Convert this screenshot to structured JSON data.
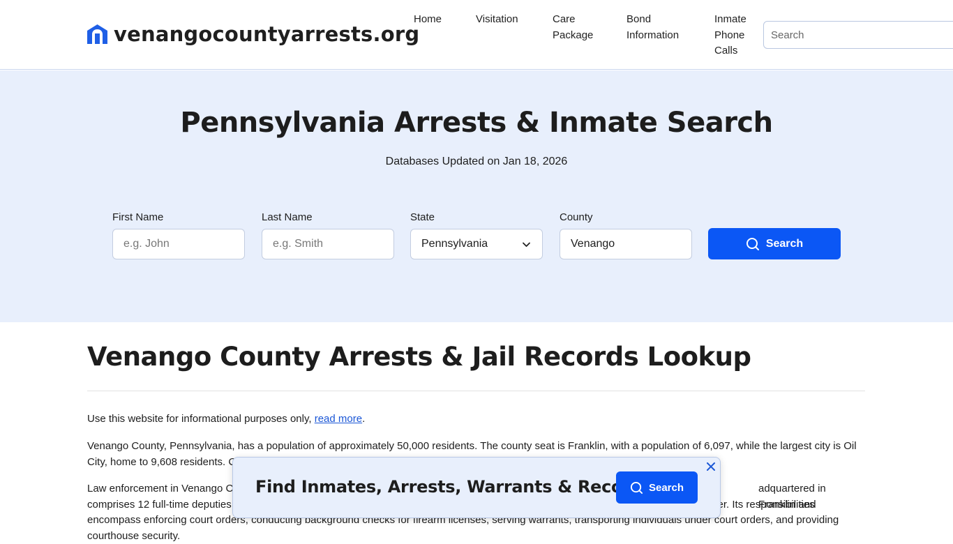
{
  "header": {
    "site_name": "venangocountyarrests.org",
    "nav": [
      {
        "label": "Home"
      },
      {
        "label": "Visitation"
      },
      {
        "label": "Care\nPackage"
      },
      {
        "label": "Bond\nInformation"
      },
      {
        "label": "Inmate\nPhone\nCalls"
      }
    ],
    "search_placeholder": "Search"
  },
  "hero": {
    "title": "Pennsylvania Arrests & Inmate Search",
    "updated": "Databases Updated on Jan 18, 2026",
    "form": {
      "first_name_label": "First Name",
      "first_name_placeholder": "e.g. John",
      "last_name_label": "Last Name",
      "last_name_placeholder": "e.g. Smith",
      "state_label": "State",
      "state_value": "Pennsylvania",
      "county_label": "County",
      "county_value": "Venango",
      "search_label": "Search"
    }
  },
  "content": {
    "title": "Venango County Arrests & Jail Records Lookup",
    "p1_before": "Use this website for informational purposes only, ",
    "p1_link": "read more",
    "p1_after": ".",
    "p2": "Venango County, Pennsylvania, has a population of approximately 50,000 residents. The county seat is Franklin, with a population of 6,097, while the largest city is Oil City, home to 9,608 residents. C",
    "p3_a": "Law enforcement in Venango C",
    "p3_b": "adquartered in Franklin and",
    "p3_c": "comprises 12 full-time deputies",
    "p3_d": "nter. Its responsibilities",
    "p3_e": "encompass enforcing court orders, conducting background checks for firearm licenses, serving warrants, transporting individuals under court orders, and providing",
    "p3_f": "courthouse security."
  },
  "popup": {
    "text": "Find Inmates, Arrests, Warrants & Records",
    "button": "Search",
    "close_icon": "close-icon"
  },
  "colors": {
    "accent": "#0b57f5",
    "hero_bg": "#e8effc",
    "link": "#1a56d6"
  }
}
